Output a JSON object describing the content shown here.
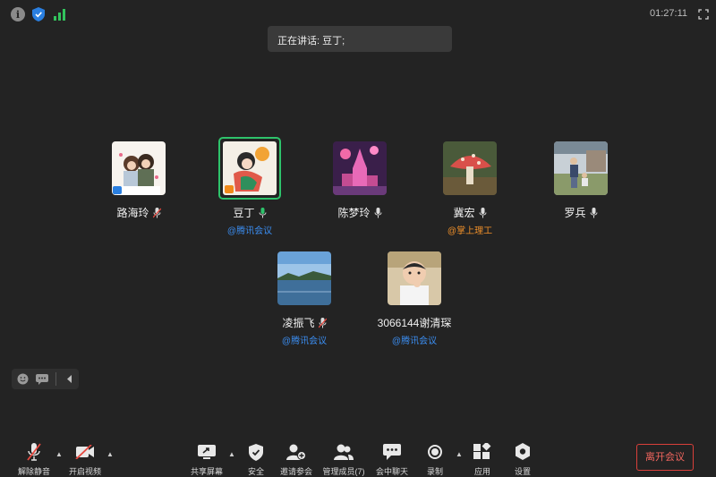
{
  "window": {
    "timer": "01:27:11"
  },
  "icons": {
    "info": "info-icon",
    "security": "shield-icon",
    "signal": "signal-icon",
    "fullscreen": "fullscreen-icon"
  },
  "speaking_banner": "正在讲话: 豆丁;",
  "participants": [
    {
      "name": "路海玲",
      "mic": "muted",
      "tag": "",
      "badge": "blue",
      "active": false
    },
    {
      "name": "豆丁",
      "mic": "on",
      "tag": "@腾讯会议",
      "tag_color": "#3b8df0",
      "badge": "orange",
      "active": true
    },
    {
      "name": "陈梦玲",
      "mic": "on",
      "tag": "",
      "active": false
    },
    {
      "name": "冀宏",
      "mic": "on",
      "tag": "@掌上理工",
      "tag_color": "#f0902a",
      "active": false
    },
    {
      "name": "罗兵",
      "mic": "on",
      "tag": "",
      "active": false
    },
    {
      "name": "凌振飞",
      "mic": "muted",
      "tag": "@腾讯会议",
      "tag_color": "#3b8df0",
      "active": false
    },
    {
      "name": "3066144谢清琛",
      "mic": "none",
      "tag": "@腾讯会议",
      "tag_color": "#3b8df0",
      "active": false
    }
  ],
  "toolbar": {
    "unmute": "解除静音",
    "video": "开启视频",
    "share": "共享屏幕",
    "security": "安全",
    "invite": "邀请参会",
    "manage": "管理成员(7)",
    "chat": "会中聊天",
    "record": "录制",
    "apps": "应用",
    "settings": "设置",
    "leave": "离开会议"
  },
  "colors": {
    "background": "#232323",
    "active_border": "#2ec36b",
    "link_blue": "#3b8df0",
    "link_orange": "#f0902a",
    "leave_red": "#d9403a",
    "signal_green": "#32c35c",
    "shield_blue": "#2a7fe0"
  }
}
